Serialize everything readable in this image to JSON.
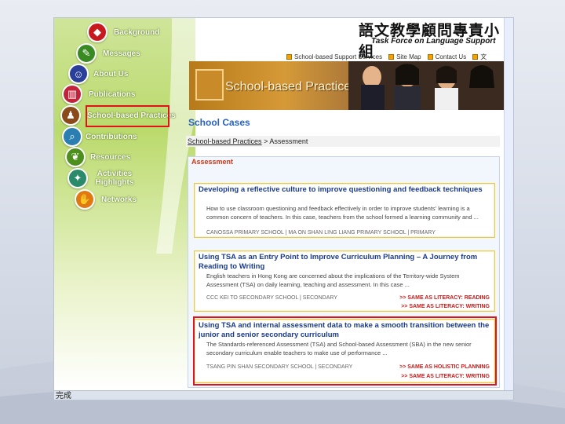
{
  "statusbar": {
    "text": "完成"
  },
  "nav": {
    "items": [
      {
        "label": "Background",
        "icon": "hat-icon",
        "color": "#c8191e"
      },
      {
        "label": "Messages",
        "icon": "pen-icon",
        "color": "#3a8a24"
      },
      {
        "label": "About Us",
        "icon": "people-icon",
        "color": "#2a3f9a"
      },
      {
        "label": "Publications",
        "icon": "books-icon",
        "color": "#c2223a"
      },
      {
        "label": "School-based Practices",
        "icon": "teacher-icon",
        "color": "#8a4a1a"
      },
      {
        "label": "Contributions",
        "icon": "magnifier-icon",
        "color": "#2a7fb0"
      },
      {
        "label": "Resources",
        "icon": "leaf-icon",
        "color": "#4d8f1d"
      },
      {
        "label": "Activities Highlights",
        "icon": "figures-icon",
        "color": "#2a8a6a"
      },
      {
        "label": "Networks",
        "icon": "handshake-icon",
        "color": "#e07a10"
      }
    ]
  },
  "header": {
    "title_cn": "語文教學顧問專責小組",
    "title_en": "Task Force on Language Support",
    "links": [
      "School-based Support Services",
      "Site Map",
      "Contact Us",
      "文"
    ]
  },
  "banner": {
    "title": "School-based Practices"
  },
  "main": {
    "heading": "School Cases",
    "breadcrumb": {
      "link": "School-based Practices",
      "separator": ">",
      "current": "Assessment"
    },
    "section_label": "Assessment",
    "cases": [
      {
        "title": "Developing a reflective culture to improve questioning and feedback techniques",
        "desc": "How to use classroom questioning and feedback effectively in order to improve students' learning is a common concern of teachers. In this case, teachers from the school formed a learning community and ...",
        "school": "CANOSSA PRIMARY SCHOOL | MA ON SHAN LING LIANG PRIMARY SCHOOL | PRIMARY",
        "tags": []
      },
      {
        "title": "Using TSA as an Entry Point to Improve Curriculum Planning – A Journey from Reading to Writing",
        "desc": "English teachers in Hong Kong are concerned about the implications of the Territory-wide System Assessment (TSA) on daily learning, teaching and assessment. In this case ...",
        "school": "CCC KEI TO SECONDARY SCHOOL | SECONDARY",
        "tags": [
          ">> SAME AS LITERACY: READING",
          ">> SAME AS LITERACY: WRITING"
        ]
      },
      {
        "title": "Using TSA and internal assessment data to make a smooth transition between the junior and senior secondary curriculum",
        "desc": "The Standards-referenced Assessment (TSA) and School-based Assessment (SBA) in the new senior secondary curriculum enable teachers to make use of performance ...",
        "school": "TSANG PIN SHAN SECONDARY SCHOOL | SECONDARY",
        "tags": [
          ">> SAME AS HOLISTIC PLANNING",
          ">> SAME AS LITERACY: WRITING"
        ]
      }
    ]
  },
  "colors": {
    "accent_blue": "#2a62c4",
    "highlight_red": "#e0121a",
    "nav_green": "#bada6c"
  }
}
